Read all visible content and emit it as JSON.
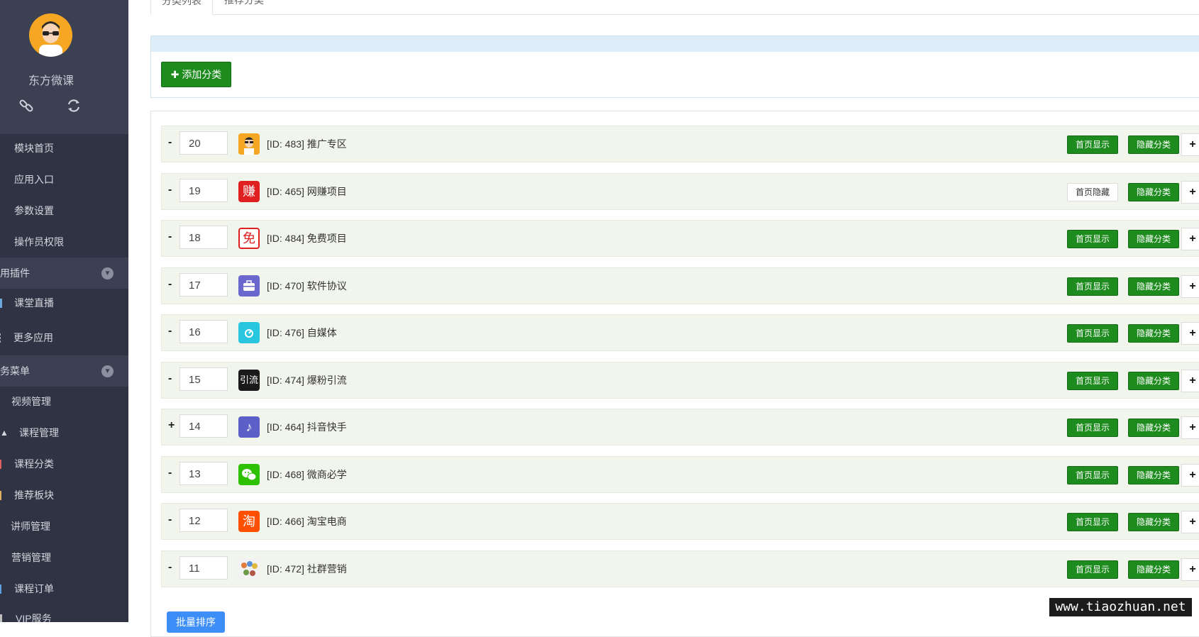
{
  "sidebar": {
    "brand": "东方微课",
    "top_icons": [
      "link-icon",
      "refresh-icon"
    ],
    "items_top": [
      {
        "label": "模块首页"
      },
      {
        "label": "应用入口"
      },
      {
        "label": "参数设置"
      },
      {
        "label": "操作员权限"
      }
    ],
    "group1": {
      "label": "用插件"
    },
    "group1_items": [
      {
        "label": "课堂直播"
      },
      {
        "label": "更多应用"
      }
    ],
    "group2": {
      "label": "务菜单"
    },
    "group2_items": [
      {
        "label": "视频管理"
      },
      {
        "label": "课程管理"
      },
      {
        "label": "课程分类"
      },
      {
        "label": "推荐板块"
      },
      {
        "label": "讲师管理"
      },
      {
        "label": "营销管理"
      },
      {
        "label": "课程订单"
      },
      {
        "label": "VIP服务"
      }
    ]
  },
  "tabs": [
    {
      "label": "分类列表"
    },
    {
      "label": "推荐分类"
    }
  ],
  "add_button": {
    "label": "添加分类",
    "icon": "plus-icon"
  },
  "categories": [
    {
      "toggle": "-",
      "order": "20",
      "name": "[ID: 483] 推广专区",
      "icon": "avatar-person-icon",
      "icon_text": "",
      "icon_color": "#f5a623",
      "home_label": "首页显示",
      "home_state": "on"
    },
    {
      "toggle": "-",
      "order": "19",
      "name": "[ID: 465] 网赚项目",
      "icon": "zhuan-char-icon",
      "icon_text": "赚",
      "icon_color": "#e02020",
      "home_label": "首页隐藏",
      "home_state": "off"
    },
    {
      "toggle": "-",
      "order": "18",
      "name": "[ID: 484] 免费项目",
      "icon": "mian-char-icon",
      "icon_text": "免",
      "icon_color": "#ffffff",
      "home_label": "首页显示",
      "home_state": "on"
    },
    {
      "toggle": "-",
      "order": "17",
      "name": "[ID: 470] 软件协议",
      "icon": "briefcase-icon",
      "icon_text": "",
      "icon_color": "#6a67ce",
      "home_label": "首页显示",
      "home_state": "on"
    },
    {
      "toggle": "-",
      "order": "16",
      "name": "[ID: 476] 自媒体",
      "icon": "media-icon",
      "icon_text": "",
      "icon_color": "#29c6e0",
      "home_label": "首页显示",
      "home_state": "on"
    },
    {
      "toggle": "-",
      "order": "15",
      "name": "[ID: 474] 爆粉引流",
      "icon": "yinliu-text-icon",
      "icon_text": "引流",
      "icon_color": "#1a1a1a",
      "home_label": "首页显示",
      "home_state": "on"
    },
    {
      "toggle": "+",
      "order": "14",
      "name": "[ID: 464] 抖音快手",
      "icon": "tiktok-icon",
      "icon_text": "♪",
      "icon_color": "#5b5fc7",
      "home_label": "首页显示",
      "home_state": "on"
    },
    {
      "toggle": "-",
      "order": "13",
      "name": "[ID: 468] 微商必学",
      "icon": "wechat-icon",
      "icon_text": "",
      "icon_color": "#2dc100",
      "home_label": "首页显示",
      "home_state": "on"
    },
    {
      "toggle": "-",
      "order": "12",
      "name": "[ID: 466] 淘宝电商",
      "icon": "taobao-icon",
      "icon_text": "淘",
      "icon_color": "#ff5000",
      "home_label": "首页显示",
      "home_state": "on"
    },
    {
      "toggle": "-",
      "order": "11",
      "name": "[ID: 472] 社群营销",
      "icon": "community-icon",
      "icon_text": "",
      "icon_color": "#f2f2f2",
      "home_label": "首页显示",
      "home_state": "on"
    }
  ],
  "hide_label": "隐藏分类",
  "row_add_label": "+",
  "bulk_button": {
    "label": "批量排序"
  },
  "watermark": "www.tiaozhuan.net"
}
